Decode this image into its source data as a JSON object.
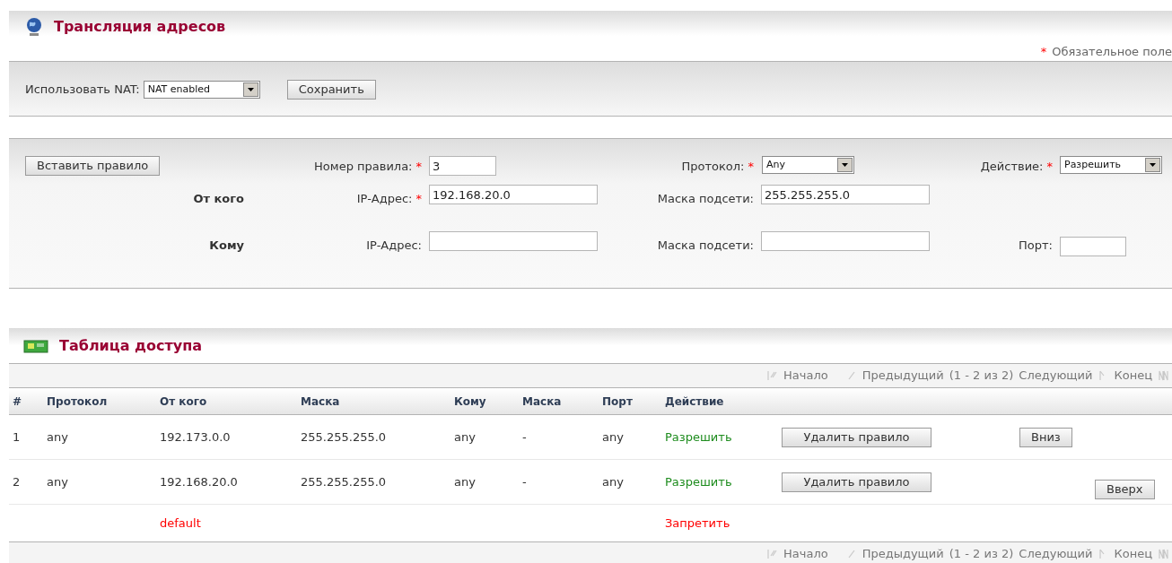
{
  "header": {
    "title": "Трансляция адресов",
    "required_mark": "*",
    "required_note": "Обязательное поле"
  },
  "nat": {
    "label": "Использовать NAT:",
    "value": "NAT enabled",
    "save_button": "Сохранить"
  },
  "rule_form": {
    "insert_button": "Вставить правило",
    "rule_number": {
      "label": "Номер правила:",
      "required_mark": "*",
      "value": "3"
    },
    "protocol": {
      "label": "Протокол:",
      "required_mark": "*",
      "value": "Any"
    },
    "action": {
      "label": "Действие:",
      "required_mark": "*",
      "value": "Разрешить"
    },
    "from": {
      "heading": "От кого",
      "ip": {
        "label": "IP-Адрес:",
        "required_mark": "*",
        "value": "192.168.20.0"
      },
      "mask": {
        "label": "Маска подсети:",
        "value": "255.255.255.0"
      }
    },
    "to": {
      "heading": "Кому",
      "ip": {
        "label": "IP-Адрес:"
      },
      "mask": {
        "label": "Маска подсети:"
      },
      "port": {
        "label": "Порт:"
      }
    }
  },
  "access_table": {
    "title": "Таблица доступа",
    "pager_top": {
      "first": "Начало",
      "prev": "Предыдущий",
      "range": "(1 - 2 из 2)",
      "next": "Следующий",
      "last": "Конец"
    },
    "columns": [
      "#",
      "Протокол",
      "От кого",
      "Маска",
      "Кому",
      "Маска",
      "Порт",
      "Действие"
    ],
    "rows": [
      {
        "kind": "rule",
        "cells": [
          "1",
          "any",
          "192.173.0.0",
          "255.255.255.0",
          "any",
          "-",
          "any"
        ],
        "action": "Разрешить",
        "color": "#1e8c1e",
        "delete_button": "Удалить правило",
        "move": {
          "kind": "down",
          "label": "Вниз"
        }
      },
      {
        "kind": "rule",
        "cells": [
          "2",
          "any",
          "192.168.20.0",
          "255.255.255.0",
          "any",
          "-",
          "any"
        ],
        "action": "Разрешить",
        "color": "#1e8c1e",
        "delete_button": "Удалить правило",
        "move": {
          "kind": "up",
          "label": "Вверх"
        }
      },
      {
        "kind": "default",
        "label": "default",
        "action": "Запретить",
        "color": "#ff0000"
      }
    ],
    "pager_bottom": {
      "first": "Начало",
      "prev": "Предыдущий",
      "range": "(1 - 2 из 2)",
      "next": "Следующий",
      "last": "Конец"
    }
  }
}
